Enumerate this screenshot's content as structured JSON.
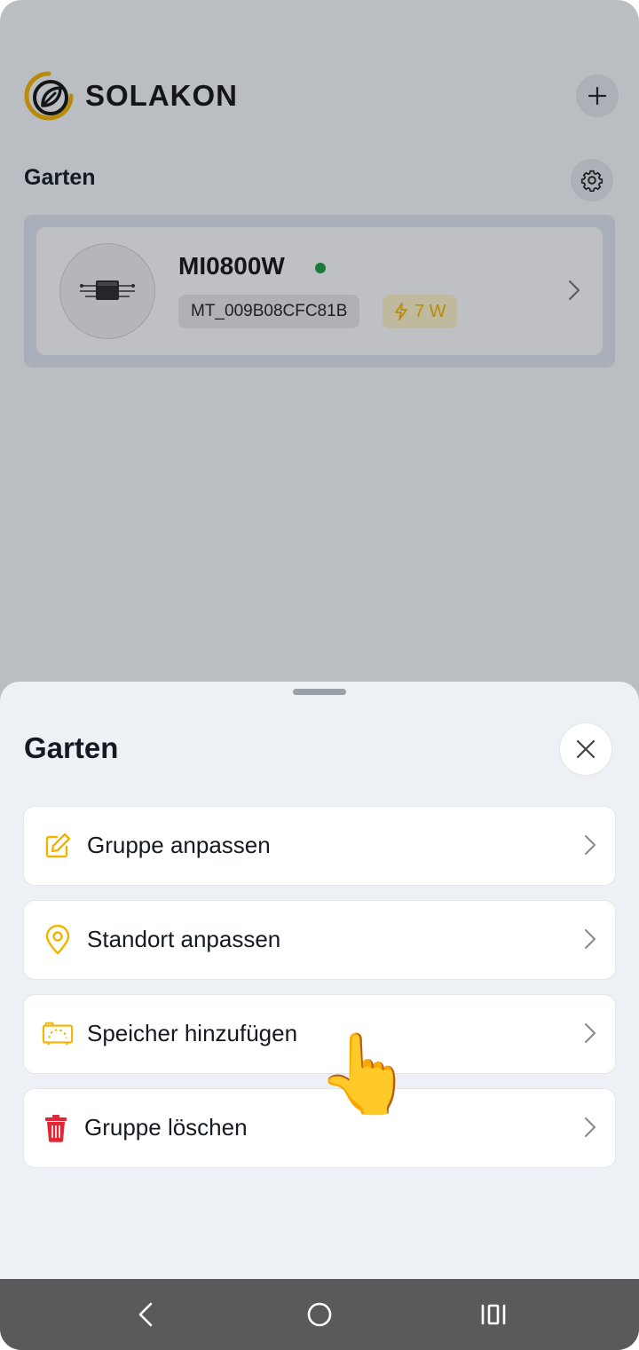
{
  "app": {
    "brand": "SOLAKON",
    "brand_color": "#F2B400",
    "icons": {
      "add": "plus-icon",
      "settings": "gear-icon"
    }
  },
  "group": {
    "title": "Garten",
    "device": {
      "name": "MI0800W",
      "status_color": "#1F9C3F",
      "serial": "MT_009B08CFC81B",
      "power": "7 W",
      "power_icon": "lightning-icon"
    }
  },
  "sheet": {
    "title": "Garten",
    "close_icon": "close-icon",
    "items": [
      {
        "label": "Gruppe anpassen",
        "icon": "edit-icon",
        "icon_color": "#F2B400"
      },
      {
        "label": "Standort anpassen",
        "icon": "location-pin-icon",
        "icon_color": "#F2B400"
      },
      {
        "label": "Speicher hinzufügen",
        "icon": "battery-storage-icon",
        "icon_color": "#F2B400"
      },
      {
        "label": "Gruppe löschen",
        "icon": "trash-icon",
        "icon_color": "#E32636"
      }
    ]
  },
  "navbar": {
    "back": "back-icon",
    "home": "home-icon",
    "recents": "recents-icon"
  }
}
